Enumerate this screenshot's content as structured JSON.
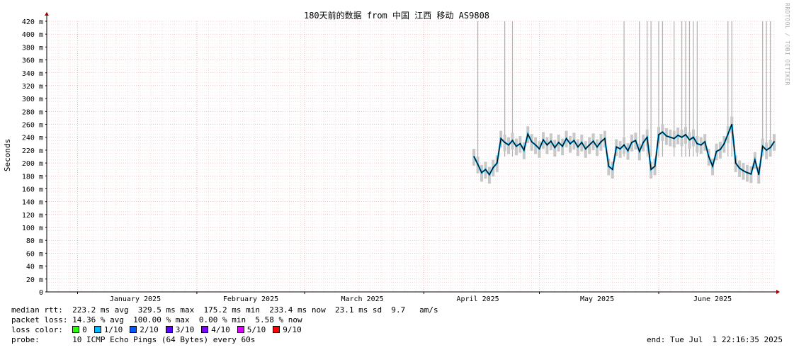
{
  "chart_data": {
    "type": "line",
    "title": "180天前的数据 from 中国 江西 移动 AS9808",
    "ylabel": "Seconds",
    "xlabel": "",
    "ylim": [
      0,
      420
    ],
    "y_ticks": [
      "0",
      "20 m",
      "40 m",
      "60 m",
      "80 m",
      "100 m",
      "120 m",
      "140 m",
      "160 m",
      "180 m",
      "200 m",
      "220 m",
      "240 m",
      "260 m",
      "280 m",
      "300 m",
      "320 m",
      "340 m",
      "360 m",
      "380 m",
      "400 m",
      "420 m"
    ],
    "x_labels": [
      "January 2025",
      "February 2025",
      "March 2025",
      "April 2025",
      "May 2025",
      "June 2025"
    ],
    "grid": true,
    "series": [
      {
        "name": "median rtt",
        "unit": "ms",
        "color": "#000000",
        "points": [
          [
            "2025-04-14",
            210
          ],
          [
            "2025-04-15",
            198
          ],
          [
            "2025-04-16",
            185
          ],
          [
            "2025-04-17",
            190
          ],
          [
            "2025-04-18",
            182
          ],
          [
            "2025-04-19",
            193
          ],
          [
            "2025-04-20",
            200
          ],
          [
            "2025-04-21",
            238
          ],
          [
            "2025-04-22",
            232
          ],
          [
            "2025-04-23",
            228
          ],
          [
            "2025-04-24",
            235
          ],
          [
            "2025-04-25",
            226
          ],
          [
            "2025-04-26",
            230
          ],
          [
            "2025-04-27",
            220
          ],
          [
            "2025-04-28",
            245
          ],
          [
            "2025-04-29",
            233
          ],
          [
            "2025-04-30",
            228
          ],
          [
            "2025-05-01",
            222
          ],
          [
            "2025-05-02",
            236
          ],
          [
            "2025-05-03",
            228
          ],
          [
            "2025-05-04",
            234
          ],
          [
            "2025-05-05",
            224
          ],
          [
            "2025-05-06",
            232
          ],
          [
            "2025-05-07",
            226
          ],
          [
            "2025-05-08",
            238
          ],
          [
            "2025-05-09",
            230
          ],
          [
            "2025-05-10",
            235
          ],
          [
            "2025-05-11",
            225
          ],
          [
            "2025-05-12",
            232
          ],
          [
            "2025-05-13",
            222
          ],
          [
            "2025-05-14",
            228
          ],
          [
            "2025-05-15",
            234
          ],
          [
            "2025-05-16",
            225
          ],
          [
            "2025-05-17",
            233
          ],
          [
            "2025-05-18",
            238
          ],
          [
            "2025-05-19",
            195
          ],
          [
            "2025-05-20",
            190
          ],
          [
            "2025-05-21",
            225
          ],
          [
            "2025-05-22",
            222
          ],
          [
            "2025-05-23",
            228
          ],
          [
            "2025-05-24",
            219
          ],
          [
            "2025-05-25",
            232
          ],
          [
            "2025-05-26",
            235
          ],
          [
            "2025-05-27",
            218
          ],
          [
            "2025-05-28",
            232
          ],
          [
            "2025-05-29",
            240
          ],
          [
            "2025-05-30",
            190
          ],
          [
            "2025-05-31",
            195
          ],
          [
            "2025-06-01",
            244
          ],
          [
            "2025-06-02",
            248
          ],
          [
            "2025-06-03",
            242
          ],
          [
            "2025-06-04",
            240
          ],
          [
            "2025-06-05",
            238
          ],
          [
            "2025-06-06",
            243
          ],
          [
            "2025-06-07",
            240
          ],
          [
            "2025-06-08",
            244
          ],
          [
            "2025-06-09",
            236
          ],
          [
            "2025-06-10",
            240
          ],
          [
            "2025-06-11",
            230
          ],
          [
            "2025-06-12",
            228
          ],
          [
            "2025-06-13",
            233
          ],
          [
            "2025-06-14",
            210
          ],
          [
            "2025-06-15",
            195
          ],
          [
            "2025-06-16",
            218
          ],
          [
            "2025-06-17",
            221
          ],
          [
            "2025-06-18",
            230
          ],
          [
            "2025-06-19",
            245
          ],
          [
            "2025-06-20",
            260
          ],
          [
            "2025-06-21",
            200
          ],
          [
            "2025-06-22",
            192
          ],
          [
            "2025-06-23",
            188
          ],
          [
            "2025-06-24",
            185
          ],
          [
            "2025-06-25",
            183
          ],
          [
            "2025-06-26",
            205
          ],
          [
            "2025-06-27",
            182
          ],
          [
            "2025-06-28",
            226
          ],
          [
            "2025-06-29",
            220
          ],
          [
            "2025-06-30",
            224
          ],
          [
            "2025-07-01",
            233
          ]
        ]
      }
    ],
    "spikes": [
      {
        "x": "2025-04-15",
        "y": 420
      },
      {
        "x": "2025-04-22",
        "y": 420
      },
      {
        "x": "2025-04-24",
        "y": 420
      },
      {
        "x": "2025-05-23",
        "y": 420
      },
      {
        "x": "2025-05-27",
        "y": 420
      },
      {
        "x": "2025-05-29",
        "y": 420
      },
      {
        "x": "2025-05-30",
        "y": 420
      },
      {
        "x": "2025-06-01",
        "y": 420
      },
      {
        "x": "2025-06-02",
        "y": 420
      },
      {
        "x": "2025-06-05",
        "y": 420
      },
      {
        "x": "2025-06-07",
        "y": 420
      },
      {
        "x": "2025-06-08",
        "y": 420
      },
      {
        "x": "2025-06-09",
        "y": 420
      },
      {
        "x": "2025-06-10",
        "y": 420
      },
      {
        "x": "2025-06-11",
        "y": 420
      },
      {
        "x": "2025-06-19",
        "y": 420
      },
      {
        "x": "2025-06-20",
        "y": 420
      },
      {
        "x": "2025-06-28",
        "y": 420
      },
      {
        "x": "2025-06-29",
        "y": 420
      },
      {
        "x": "2025-06-30",
        "y": 420
      }
    ],
    "x_start": "2024-12-24",
    "x_end": "2025-07-01"
  },
  "stats": {
    "median_rtt": "median rtt:  223.2 ms avg  329.5 ms max  175.2 ms min  233.4 ms now  23.1 ms sd  9.7   am/s",
    "packet_loss": "packet loss: 14.36 % avg  100.00 % max  0.00 % min  5.58 % now",
    "loss_color_label": "loss color:",
    "probe": "probe:       10 ICMP Echo Pings (64 Bytes) every 60s",
    "end": "end: Tue Jul  1 22:16:35 2025"
  },
  "loss_colors": [
    {
      "label": "0",
      "color": "#26ff00"
    },
    {
      "label": "1/10",
      "color": "#00b8ff"
    },
    {
      "label": "2/10",
      "color": "#0059ff"
    },
    {
      "label": "3/10",
      "color": "#5e00ff"
    },
    {
      "label": "4/10",
      "color": "#7e00ff"
    },
    {
      "label": "5/10",
      "color": "#dd00ff"
    },
    {
      "label": "9/10",
      "color": "#ff0000"
    }
  ],
  "watermark": "RRDTOOL / TOBI OETIKER"
}
